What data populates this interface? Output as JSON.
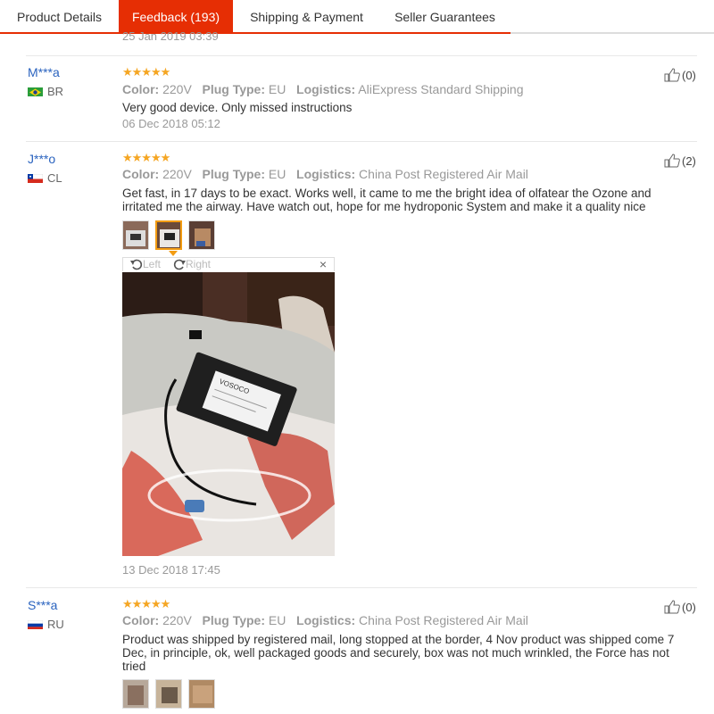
{
  "tabs": [
    {
      "label": "Product Details"
    },
    {
      "label": "Feedback (193)"
    },
    {
      "label": "Shipping & Payment"
    },
    {
      "label": "Seller Guarantees"
    }
  ],
  "prev_date": "25 Jan 2019 03:39",
  "labels": {
    "color": "Color:",
    "plug": "Plug Type:",
    "logistics": "Logistics:",
    "stars": "★★★★★"
  },
  "reviews": [
    {
      "user": "M***a",
      "country": "BR",
      "color": "220V",
      "plug": "EU",
      "logistics": "AliExpress Standard Shipping",
      "text": "Very good device. Only missed instructions",
      "date": "06 Dec 2018 05:12",
      "helpful": "(0)"
    },
    {
      "user": "J***o",
      "country": "CL",
      "color": "220V",
      "plug": "EU",
      "logistics": "China Post Registered Air Mail",
      "text": "Get fast, in 17 days to be exact. Works well, it came to me the bright idea of olfatear the Ozone and irritated me the airway. Have watch out, hope for me hydroponic System and make it a quality nice",
      "date": "13 Dec 2018 17:45",
      "helpful": "(2)",
      "viewer": {
        "left": "Left",
        "right": "Right",
        "close": "×",
        "brand": "VOSOCO"
      }
    },
    {
      "user": "S***a",
      "country": "RU",
      "color": "220V",
      "plug": "EU",
      "logistics": "China Post Registered Air Mail",
      "text": "Product was shipped by registered mail, long stopped at the border, 4 Nov product was shipped come 7 Dec, in principle, ok, well packaged goods and securely, box was not much wrinkled, the Force has not tried",
      "helpful": "(0)"
    }
  ],
  "colors": {
    "accent": "#e62e04",
    "star": "#f5a623",
    "user": "#2a63bf"
  }
}
